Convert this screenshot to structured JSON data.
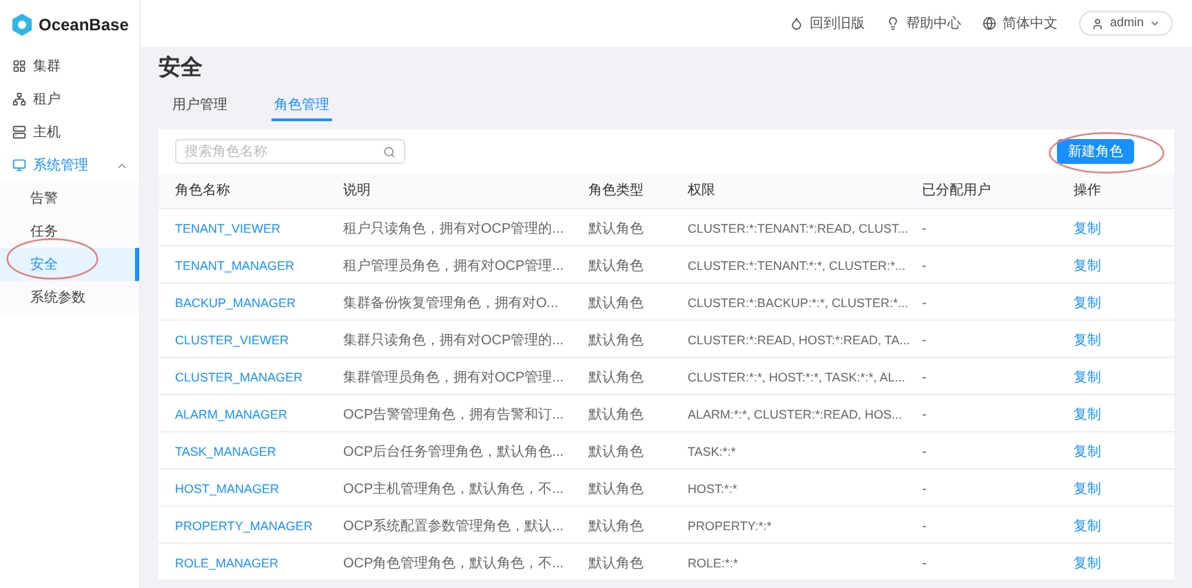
{
  "logo": {
    "text": "OceanBase"
  },
  "sidebar": {
    "items": [
      {
        "label": "集群",
        "selected": false
      },
      {
        "label": "租户",
        "selected": false
      },
      {
        "label": "主机",
        "selected": false
      },
      {
        "label": "系统管理",
        "selected": false,
        "active": true,
        "expanded": true,
        "children": [
          {
            "label": "告警",
            "selected": false
          },
          {
            "label": "任务",
            "selected": false
          },
          {
            "label": "安全",
            "selected": true
          },
          {
            "label": "系统参数",
            "selected": false
          }
        ]
      }
    ]
  },
  "header": {
    "links": [
      "回到旧版",
      "帮助中心",
      "简体中文"
    ],
    "user": "admin"
  },
  "page": {
    "title": "安全"
  },
  "tabs": [
    {
      "label": "用户管理",
      "selected": false
    },
    {
      "label": "角色管理",
      "selected": true
    }
  ],
  "search": {
    "placeholder": "搜索角色名称"
  },
  "new_button": "新建角色",
  "table": {
    "columns": [
      "角色名称",
      "说明",
      "角色类型",
      "权限",
      "已分配用户",
      "操作"
    ],
    "rows": [
      [
        "TENANT_VIEWER",
        "租户只读角色，拥有对OCP管理的...",
        "默认角色",
        "CLUSTER:*:TENANT:*:READ, CLUST...",
        "-",
        "复制"
      ],
      [
        "TENANT_MANAGER",
        "租户管理员角色，拥有对OCP管理...",
        "默认角色",
        "CLUSTER:*:TENANT:*:*, CLUSTER:*...",
        "-",
        "复制"
      ],
      [
        "BACKUP_MANAGER",
        "集群备份恢复管理角色，拥有对O...",
        "默认角色",
        "CLUSTER:*:BACKUP:*:*, CLUSTER:*...",
        "-",
        "复制"
      ],
      [
        "CLUSTER_VIEWER",
        "集群只读角色，拥有对OCP管理的...",
        "默认角色",
        "CLUSTER:*:READ, HOST:*:READ, TA...",
        "-",
        "复制"
      ],
      [
        "CLUSTER_MANAGER",
        "集群管理员角色，拥有对OCP管理...",
        "默认角色",
        "CLUSTER:*:*, HOST:*:*, TASK:*:*, AL...",
        "-",
        "复制"
      ],
      [
        "ALARM_MANAGER",
        "OCP告警管理角色，拥有告警和订...",
        "默认角色",
        "ALARM:*:*, CLUSTER:*:READ, HOS...",
        "-",
        "复制"
      ],
      [
        "TASK_MANAGER",
        "OCP后台任务管理角色，默认角色...",
        "默认角色",
        "TASK:*:*",
        "-",
        "复制"
      ],
      [
        "HOST_MANAGER",
        "OCP主机管理角色，默认角色，不...",
        "默认角色",
        "HOST:*:*",
        "-",
        "复制"
      ],
      [
        "PROPERTY_MANAGER",
        "OCP系统配置参数管理角色，默认...",
        "默认角色",
        "PROPERTY:*:*",
        "-",
        "复制"
      ],
      [
        "ROLE_MANAGER",
        "OCP角色管理角色，默认角色，不...",
        "默认角色",
        "ROLE:*:*",
        "-",
        "复制"
      ]
    ]
  }
}
